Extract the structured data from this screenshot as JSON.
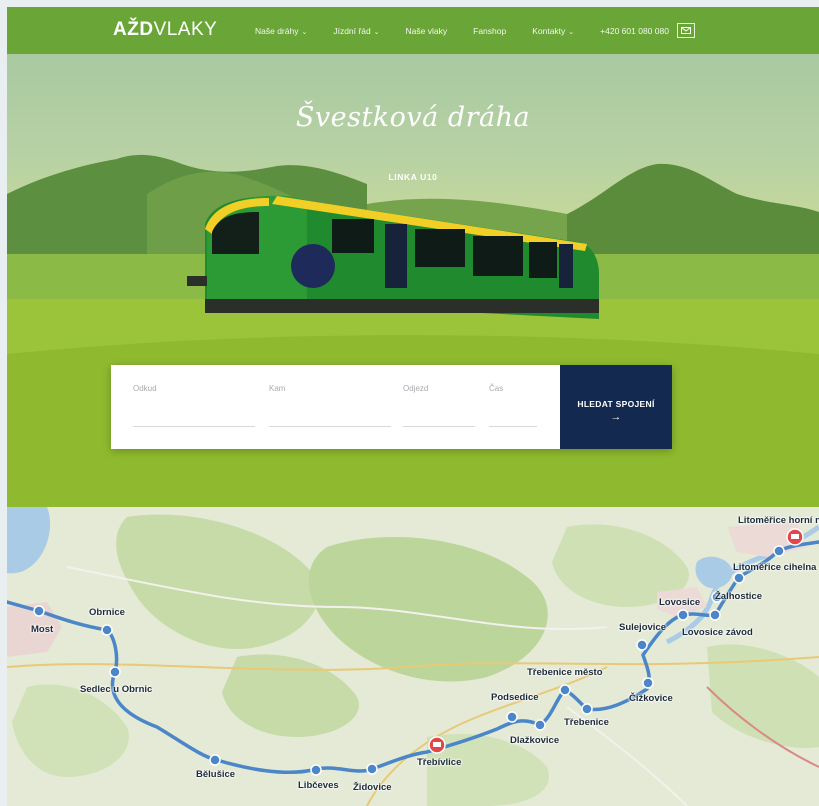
{
  "header": {
    "logo_bold": "AŽD",
    "logo_light": "VLAKY",
    "nav": [
      {
        "label": "Naše dráhy",
        "dropdown": true
      },
      {
        "label": "Jízdní řád",
        "dropdown": true
      },
      {
        "label": "Naše vlaky",
        "dropdown": false
      },
      {
        "label": "Fanshop",
        "dropdown": false
      },
      {
        "label": "Kontakty",
        "dropdown": true
      }
    ],
    "phone": "+420 601 080 080"
  },
  "hero": {
    "title": "Švestková dráha",
    "subtitle": "LINKA U10"
  },
  "search": {
    "from_label": "Odkud",
    "to_label": "Kam",
    "departure_label": "Odjezd",
    "time_label": "Čas",
    "button_label": "HLEDAT SPOJENÍ",
    "button_arrow": "→"
  },
  "map": {
    "stations": [
      "Litoměřice horní n.",
      "Litoměřice cihelna",
      "Žalhostice",
      "Lovosice",
      "Sulejovice",
      "Lovosice závod",
      "Třebenice město",
      "Čížkovice",
      "Podsedice",
      "Třebenice",
      "Dlažkovice",
      "Třebívlice",
      "Bělušice",
      "Libčeves",
      "Židovice",
      "Most",
      "Obrnice",
      "Sedlec u Obrnic"
    ]
  },
  "colors": {
    "header_green": "#6aa637",
    "button_navy": "#14294f",
    "route_blue": "#3f7fc4"
  }
}
